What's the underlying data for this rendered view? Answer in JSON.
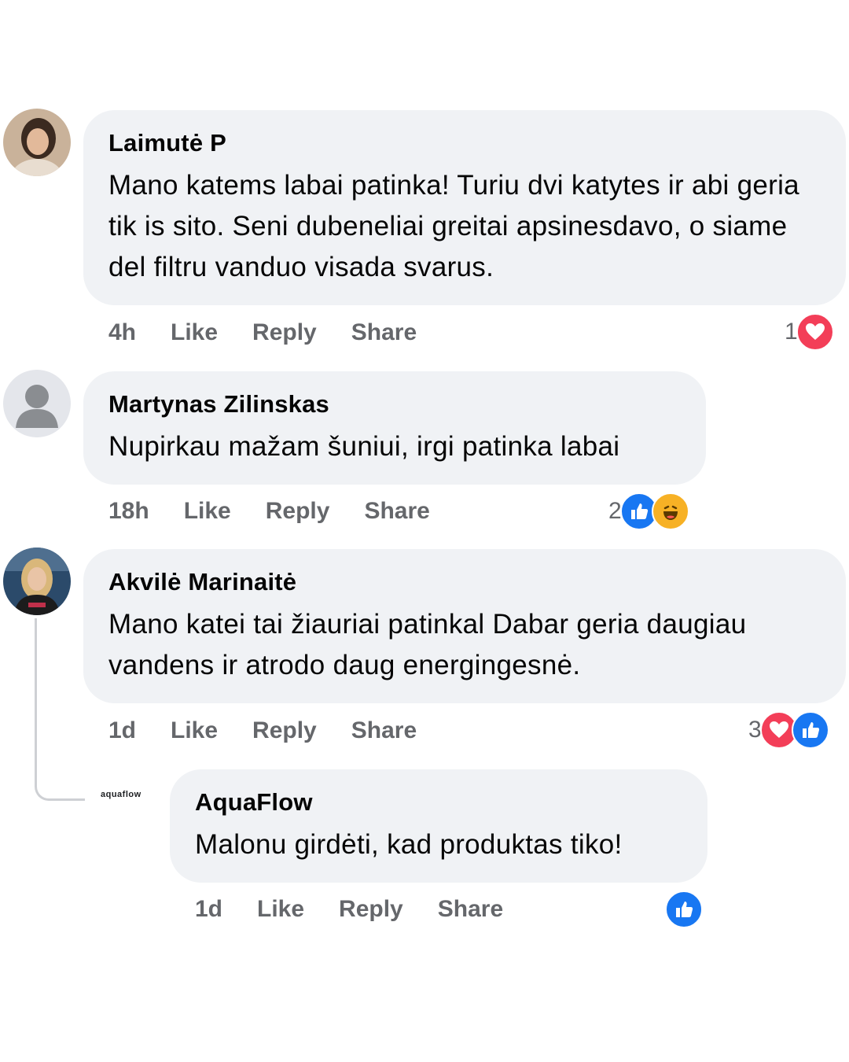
{
  "comments": [
    {
      "author": "Laimutė P",
      "text": "Mano katems labai patinka! Turiu dvi katytes ir abi geria tik is sito. Seni dubeneliai greitai apsinesdavo, o siame del filtru vanduo visada svarus.",
      "time": "4h",
      "reaction_count": "1",
      "reactions": [
        "heart-icon"
      ]
    },
    {
      "author": "Martynas Zilinskas",
      "text": "Nupirkau mažam šuniui, irgi patinka labai",
      "time": "18h",
      "reaction_count": "2",
      "reactions": [
        "like-icon",
        "haha-icon"
      ]
    },
    {
      "author": "Akvilė Marinaitė",
      "text": "Mano katei tai žiauriai patinkal Dabar geria daugiau vandens ir atrodo daug energingesnė.",
      "time": "1d",
      "reaction_count": "3",
      "reactions": [
        "heart-icon",
        "like-icon"
      ]
    },
    {
      "author": "AquaFlow",
      "text": "Malonu girdėti, kad produktas tiko!",
      "time": "1d",
      "reaction_count": "",
      "reactions": [
        "like-icon"
      ],
      "logo_text": "aquaflow"
    }
  ],
  "actions": {
    "like": "Like",
    "reply": "Reply",
    "share": "Share"
  },
  "colors": {
    "bubble": "#f0f2f5",
    "meta": "#65676b",
    "like": "#1877f2",
    "heart": "#f33e58",
    "haha": "#f7b125"
  }
}
